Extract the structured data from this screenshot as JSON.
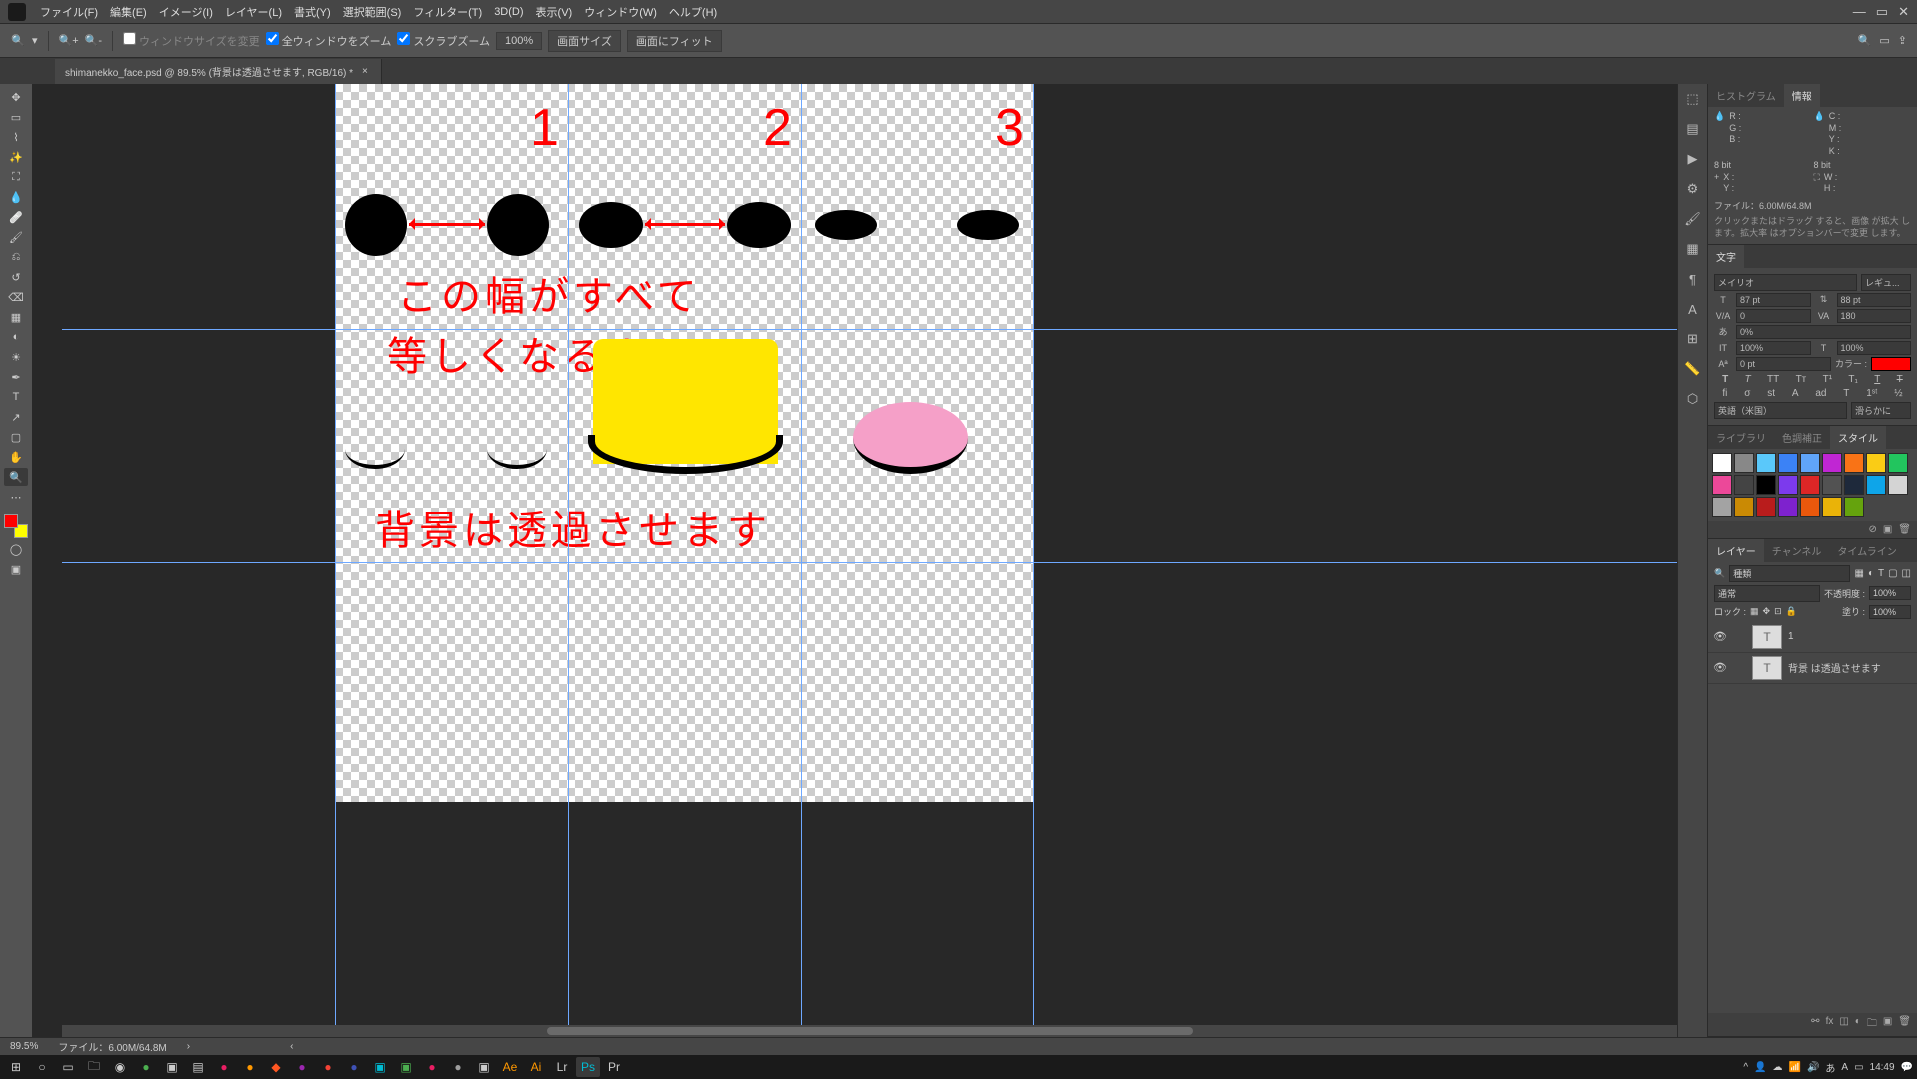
{
  "menu": {
    "items": [
      "ファイル(F)",
      "編集(E)",
      "イメージ(I)",
      "レイヤー(L)",
      "書式(Y)",
      "選択範囲(S)",
      "フィルター(T)",
      "3D(D)",
      "表示(V)",
      "ウィンドウ(W)",
      "ヘルプ(H)"
    ]
  },
  "options": {
    "resize_window": "ウィンドウサイズを変更",
    "zoom_all": "全ウィンドウをズーム",
    "scrub_zoom": "スクラブズーム",
    "zoom_pct": "100%",
    "fit_screen": "画面サイズ",
    "fit_window": "画面にフィット"
  },
  "tab": {
    "title": "shimanekko_face.psd @ 89.5% (背景は透過させます, RGB/16) *"
  },
  "canvas": {
    "num1": "1",
    "num2": "2",
    "num3": "3",
    "line1": "この幅がすべて",
    "line2": "等しくなるように！",
    "line3": "背景は透過させます"
  },
  "statusbar": {
    "zoom": "89.5%",
    "doc": "ファイル：6.00M/64.8M"
  },
  "panels": {
    "histogram": "ヒストグラム",
    "info": "情報",
    "info_rgb": {
      "r": "R :",
      "g": "G :",
      "b": "B :",
      "c": "C :",
      "m": "M :",
      "y": "Y :",
      "k": "K :"
    },
    "info_bit": "8 bit",
    "info_xy": {
      "x": "X :",
      "y": "Y :",
      "w": "W :",
      "h": "H :"
    },
    "info_file": "ファイル：6.00M/64.8M",
    "info_hint": "クリックまたはドラッグ すると、画像 が拡大 します。拡大率 はオプションバーで変更 します。",
    "char": "文字",
    "char_font": "メイリオ",
    "char_style": "レギュ...",
    "char_size": "87 pt",
    "char_leading": "88 pt",
    "char_va": "0",
    "char_kern": "180",
    "char_baseline": "0%",
    "char_hscale": "100%",
    "char_vscale": "100%",
    "char_shift": "0 pt",
    "char_color_label": "カラー :",
    "char_lang": "英語（米国）",
    "char_aa": "滑らかに",
    "library": "ライブラリ",
    "adjust": "色調補正",
    "styles": "スタイル",
    "layers": "レイヤー",
    "channels": "チャンネル",
    "timeline": "タイムライン",
    "layer_search": "種類",
    "blend_mode": "通常",
    "opacity_label": "不透明度 :",
    "opacity_val": "100%",
    "lock_label": "ロック :",
    "fill_label": "塗り :",
    "fill_val": "100%",
    "layer1_name": "1",
    "layer2_name": "背景 は透過させます"
  },
  "taskbar": {
    "time": "14:49"
  },
  "styles_colors": [
    "#fff",
    "#888",
    "#5ac8fa",
    "#3b82f6",
    "#60a5fa",
    "#c026d3",
    "#f97316",
    "#facc15",
    "#22c55e",
    "#ec4899",
    "#444",
    "#000",
    "#7c3aed",
    "#dc2626",
    "#525252",
    "#1e293b",
    "#0ea5e9",
    "#d4d4d4",
    "#a3a3a3",
    "#ca8a04",
    "#b91c1c",
    "#7e22ce",
    "#ea580c",
    "#eab308",
    "#65a30d"
  ]
}
